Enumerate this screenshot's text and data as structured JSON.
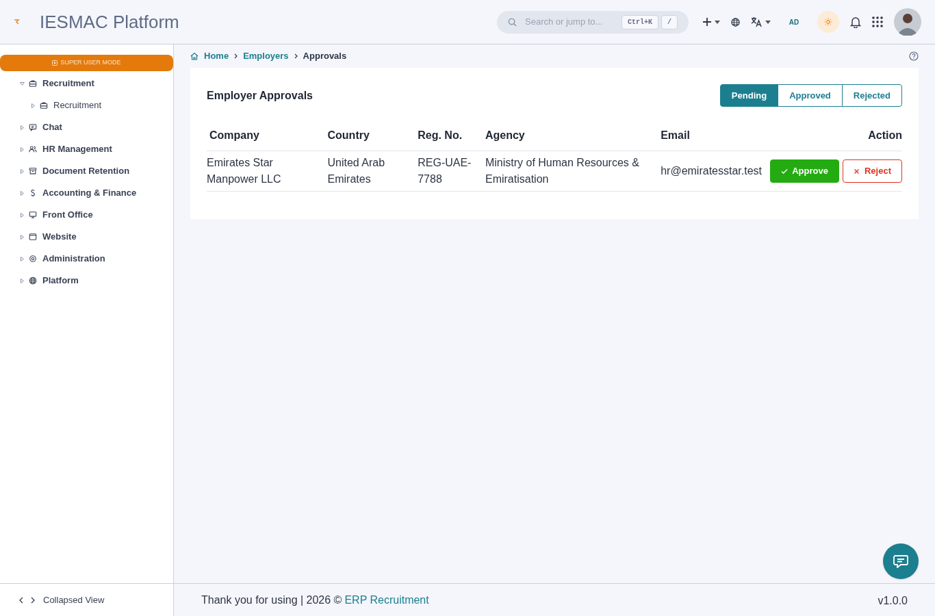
{
  "header": {
    "title": "IESMAC Platform",
    "search": {
      "placeholder": "Search or jump to...",
      "keys": [
        "Ctrl+K",
        "/"
      ]
    },
    "initials": "AD"
  },
  "sidebar": {
    "mode_badge": "SUPER USER MODE",
    "items": [
      {
        "label": "Recruitment",
        "expanded": true,
        "children": [
          {
            "label": "Recruitment",
            "expanded": false
          }
        ]
      },
      {
        "label": "Chat",
        "expanded": false
      },
      {
        "label": "HR Management",
        "expanded": false
      },
      {
        "label": "Document Retention",
        "expanded": false
      },
      {
        "label": "Accounting & Finance",
        "expanded": false
      },
      {
        "label": "Front Office",
        "expanded": false
      },
      {
        "label": "Website",
        "expanded": false
      },
      {
        "label": "Administration",
        "expanded": false
      },
      {
        "label": "Platform",
        "expanded": false
      }
    ],
    "footer": "Collapsed View"
  },
  "breadcrumb": [
    {
      "label": "Home",
      "kind": "link"
    },
    {
      "label": "Employers",
      "kind": "link"
    },
    {
      "label": "Approvals",
      "kind": "current"
    }
  ],
  "card": {
    "title": "Employer Approvals",
    "tabs": [
      {
        "label": "Pending",
        "selected": true
      },
      {
        "label": "Approved",
        "selected": false
      },
      {
        "label": "Rejected",
        "selected": false
      }
    ],
    "table": {
      "columns": [
        "Company",
        "Country",
        "Reg. No.",
        "Agency",
        "Email",
        "Action"
      ],
      "rows": [
        {
          "cells": [
            "Emirates Star Manpower LLC",
            "United Arab Emirates",
            "REG-UAE-7788",
            "Ministry of Human Resources & Emiratisation",
            "hr@emiratesstar.test"
          ],
          "actions": [
            "Approve",
            "Reject"
          ]
        }
      ]
    }
  },
  "footer": {
    "text": "Thank you for using | 2026 ©",
    "link": "ERP Recruitment",
    "version": "v1.0.0"
  }
}
